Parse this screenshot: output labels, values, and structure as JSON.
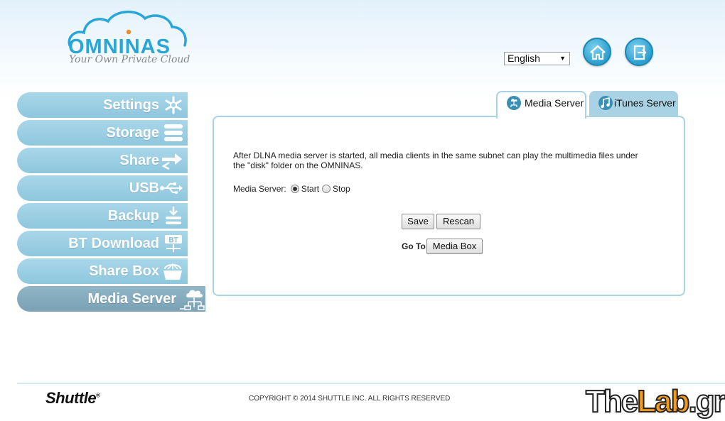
{
  "header": {
    "brand": "OMNINAS",
    "tagline": "Your Own Private Cloud",
    "language": "English"
  },
  "sidebar": {
    "items": [
      {
        "label": "Settings",
        "icon": "snowflake-gear-icon"
      },
      {
        "label": "Storage",
        "icon": "storage-stack-icon"
      },
      {
        "label": "Share",
        "icon": "share-arrows-icon"
      },
      {
        "label": "USB",
        "icon": "usb-icon"
      },
      {
        "label": "Backup",
        "icon": "backup-download-icon"
      },
      {
        "label": "BT Download",
        "icon": "bt-download-icon"
      },
      {
        "label": "Share Box",
        "icon": "share-box-icon"
      },
      {
        "label": "Media Server",
        "icon": "media-server-cloud-icon"
      }
    ],
    "active": "Media Server"
  },
  "tabs": [
    {
      "label": "Media Server",
      "icon": "media-server-tab-icon",
      "active": true
    },
    {
      "label": "iTunes Server",
      "icon": "music-note-icon",
      "active": false
    }
  ],
  "panel": {
    "description_line1": "After DLNA media server is started, all media clients in the same subnet can play the multimedia files under",
    "description_line2": "the \"disk\" folder on the OMNINAS.",
    "media_server_label": "Media Server:",
    "start_label": "Start",
    "stop_label": "Stop",
    "selected": "Start",
    "save_label": "Save",
    "rescan_label": "Rescan",
    "goto_label": "Go To",
    "media_box_label": "Media Box"
  },
  "footer": {
    "brand": "Shuttle",
    "copyright": "COPYRIGHT © 2014 SHUTTLE INC. ALL RIGHTS RESERVED",
    "watermark_part1": "The",
    "watermark_part2": "Lab",
    "watermark_part3": ".gr"
  },
  "colors": {
    "accent": "#29a6d8",
    "nav": "#a9d6e9",
    "nav_active": "#7aa2b4",
    "border": "#a9d3e4"
  }
}
